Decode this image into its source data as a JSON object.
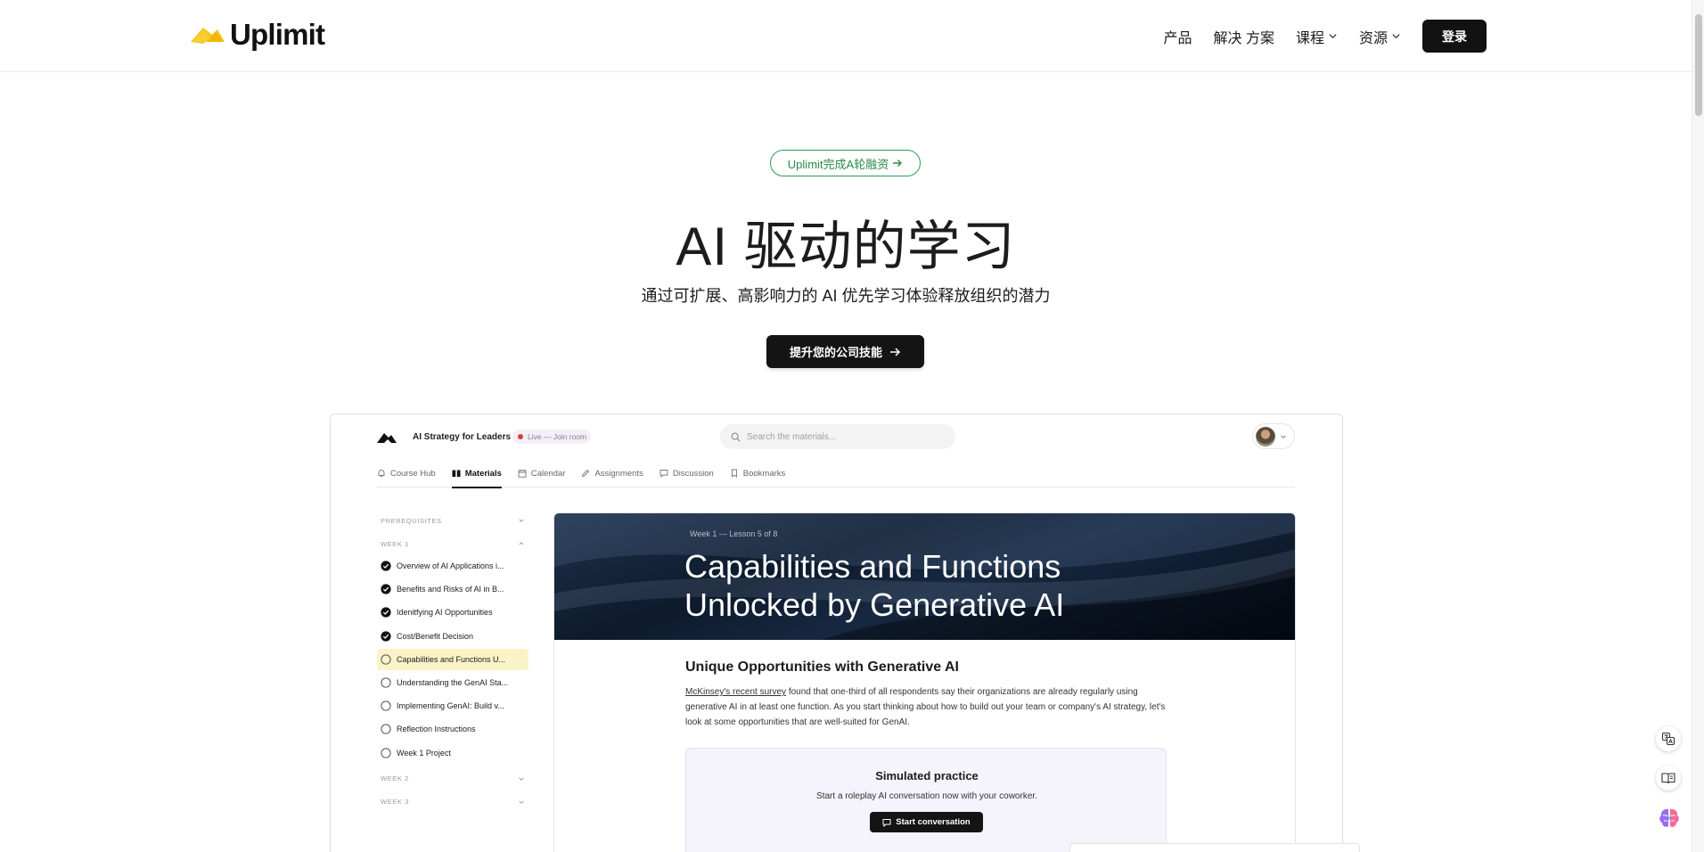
{
  "brand": {
    "name": "Uplimit",
    "accent": "#f5c518"
  },
  "nav": {
    "links": [
      "产品",
      "解决 方案",
      "课程",
      "资源"
    ],
    "login": "登录"
  },
  "hero": {
    "pill": "Uplimit完成A轮融资",
    "title": "AI 驱动的学习",
    "subtitle": "通过可扩展、高影响力的 AI 优先学习体验释放组织的潜力",
    "cta": "提升您的公司技能"
  },
  "app": {
    "course_title": "AI Strategy for Leaders",
    "live_badge": "Live — Join room",
    "search_placeholder": "Search the materials...",
    "tabs": [
      {
        "label": "Course Hub",
        "icon": "bell-icon",
        "active": false
      },
      {
        "label": "Materials",
        "icon": "book-icon",
        "active": true
      },
      {
        "label": "Calendar",
        "icon": "calendar-icon",
        "active": false
      },
      {
        "label": "Assignments",
        "icon": "pencil-icon",
        "active": false
      },
      {
        "label": "Discussion",
        "icon": "chat-icon",
        "active": false
      },
      {
        "label": "Bookmarks",
        "icon": "bookmark-icon",
        "active": false
      }
    ],
    "sidebar": {
      "sections": [
        {
          "label": "PREREQUISITES",
          "expanded": false
        },
        {
          "label": "WEEK 1",
          "expanded": true
        },
        {
          "label": "WEEK 2",
          "expanded": false
        },
        {
          "label": "WEEK 3",
          "expanded": false
        }
      ],
      "lessons": [
        {
          "label": "Overview of AI Applications i...",
          "done": true
        },
        {
          "label": "Benefits and Risks of AI in B...",
          "done": true
        },
        {
          "label": "Idenitfying AI Opportunities",
          "done": true
        },
        {
          "label": "Cost/Benefit Decision",
          "done": true
        },
        {
          "label": "Capabilities and Functions U...",
          "done": false,
          "active": true
        },
        {
          "label": "Understanding the GenAI Sta...",
          "done": false
        },
        {
          "label": "Implementing GenAI: Build v...",
          "done": false
        },
        {
          "label": "Reflection Instructions",
          "done": false
        },
        {
          "label": "Week 1 Project",
          "done": false
        }
      ]
    },
    "lesson": {
      "kicker": "Week 1 — Lesson 5 of 8",
      "title_line1": "Capabilities and Functions",
      "title_line2": "Unlocked by Generative AI",
      "heading": "Unique Opportunities with Generative AI",
      "para_link": "McKinsey's recent survey",
      "para_rest": " found that one-third of all respondents say their organizations are already regularly using generative AI in at least one function. As you start thinking about how to build out your team or company's AI strategy, let's look at some opportunities that are well-suited for GenAI.",
      "practice_title": "Simulated practice",
      "practice_sub": "Start a roleplay AI conversation now with your coworker.",
      "practice_button": "Start conversation"
    }
  },
  "floating": [
    "translate-icon",
    "reader-icon",
    "brain-icon"
  ]
}
